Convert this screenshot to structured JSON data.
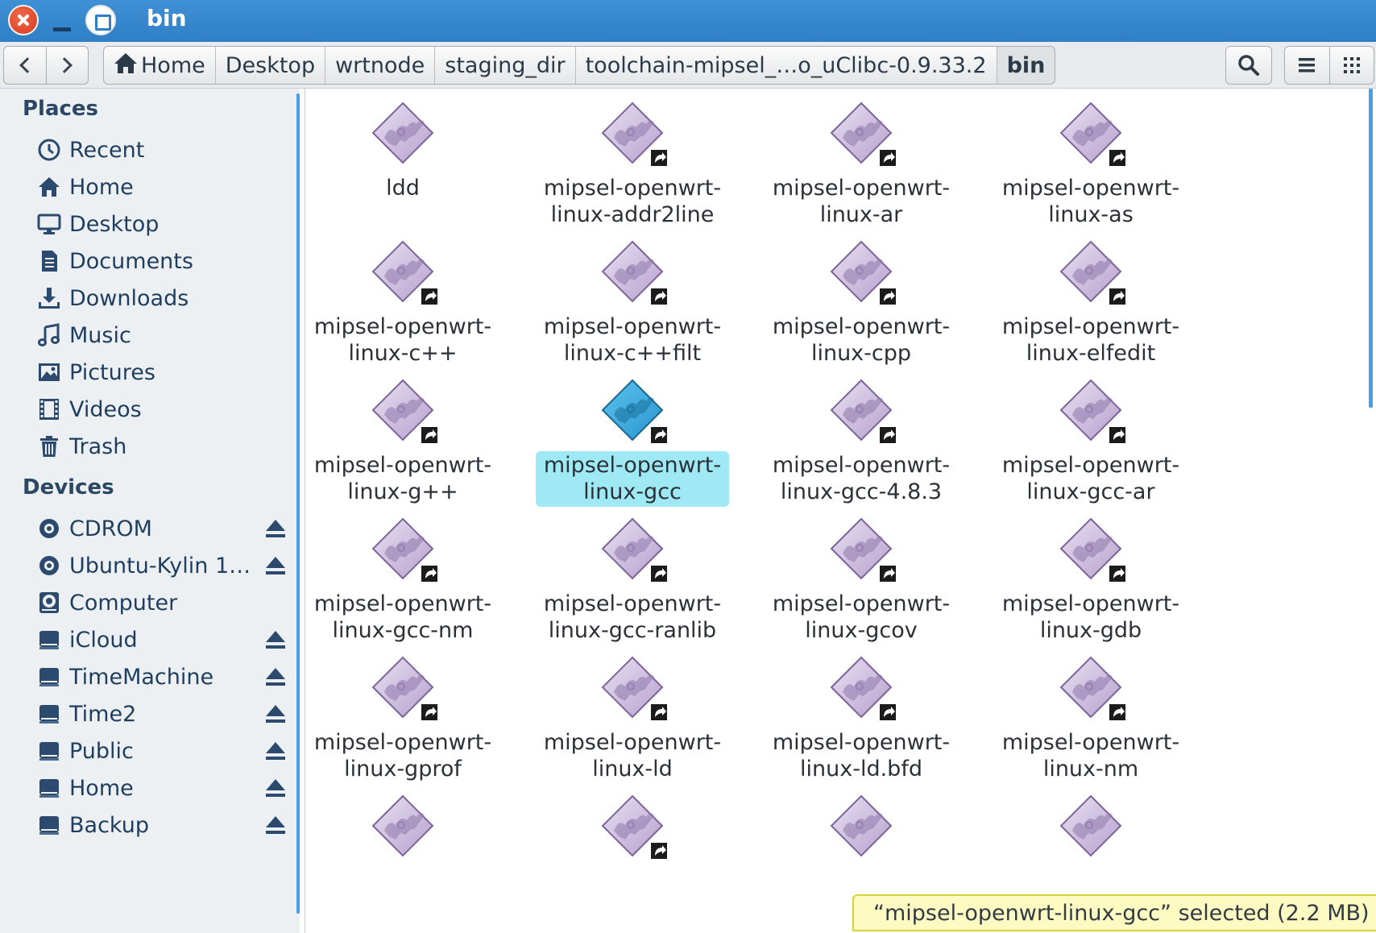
{
  "window": {
    "title": "bin"
  },
  "toolbar": {
    "breadcrumbs": [
      "Home",
      "Desktop",
      "wrtnode",
      "staging_dir",
      "toolchain-mipsel_…o_uClibc-0.9.33.2",
      "bin"
    ]
  },
  "sidebar": {
    "places_header": "Places",
    "devices_header": "Devices",
    "places": [
      {
        "label": "Recent",
        "icon": "clock-icon"
      },
      {
        "label": "Home",
        "icon": "home-icon"
      },
      {
        "label": "Desktop",
        "icon": "monitor-icon"
      },
      {
        "label": "Documents",
        "icon": "document-icon"
      },
      {
        "label": "Downloads",
        "icon": "download-icon"
      },
      {
        "label": "Music",
        "icon": "music-icon"
      },
      {
        "label": "Pictures",
        "icon": "picture-icon"
      },
      {
        "label": "Videos",
        "icon": "film-icon"
      },
      {
        "label": "Trash",
        "icon": "trash-icon"
      }
    ],
    "devices": [
      {
        "label": "CDROM",
        "icon": "disc-icon",
        "eject": true
      },
      {
        "label": "Ubuntu-Kylin 1…",
        "icon": "disc-icon",
        "eject": true
      },
      {
        "label": "Computer",
        "icon": "computer-icon",
        "eject": false
      },
      {
        "label": "iCloud",
        "icon": "drive-icon",
        "eject": true
      },
      {
        "label": "TimeMachine",
        "icon": "drive-icon",
        "eject": true
      },
      {
        "label": "Time2",
        "icon": "drive-icon",
        "eject": true
      },
      {
        "label": "Public",
        "icon": "drive-icon",
        "eject": true
      },
      {
        "label": "Home",
        "icon": "drive-icon",
        "eject": true
      },
      {
        "label": "Backup",
        "icon": "drive-icon",
        "eject": true
      }
    ]
  },
  "files": [
    {
      "name": "ldd",
      "link": false,
      "selected": false
    },
    {
      "name": "mipsel-openwrt-linux-addr2line",
      "link": true,
      "selected": false
    },
    {
      "name": "mipsel-openwrt-linux-ar",
      "link": true,
      "selected": false
    },
    {
      "name": "mipsel-openwrt-linux-as",
      "link": true,
      "selected": false
    },
    {
      "name": "mipsel-openwrt-linux-c++",
      "link": true,
      "selected": false
    },
    {
      "name": "mipsel-openwrt-linux-c++filt",
      "link": true,
      "selected": false
    },
    {
      "name": "mipsel-openwrt-linux-cpp",
      "link": true,
      "selected": false
    },
    {
      "name": "mipsel-openwrt-linux-elfedit",
      "link": true,
      "selected": false
    },
    {
      "name": "mipsel-openwrt-linux-g++",
      "link": true,
      "selected": false
    },
    {
      "name": "mipsel-openwrt-linux-gcc",
      "link": true,
      "selected": true
    },
    {
      "name": "mipsel-openwrt-linux-gcc-4.8.3",
      "link": true,
      "selected": false
    },
    {
      "name": "mipsel-openwrt-linux-gcc-ar",
      "link": true,
      "selected": false
    },
    {
      "name": "mipsel-openwrt-linux-gcc-nm",
      "link": true,
      "selected": false
    },
    {
      "name": "mipsel-openwrt-linux-gcc-ranlib",
      "link": true,
      "selected": false
    },
    {
      "name": "mipsel-openwrt-linux-gcov",
      "link": true,
      "selected": false
    },
    {
      "name": "mipsel-openwrt-linux-gdb",
      "link": true,
      "selected": false
    },
    {
      "name": "mipsel-openwrt-linux-gprof",
      "link": true,
      "selected": false
    },
    {
      "name": "mipsel-openwrt-linux-ld",
      "link": true,
      "selected": false
    },
    {
      "name": "mipsel-openwrt-linux-ld.bfd",
      "link": true,
      "selected": false
    },
    {
      "name": "mipsel-openwrt-linux-nm",
      "link": true,
      "selected": false
    },
    {
      "name": "",
      "link": false,
      "selected": false
    },
    {
      "name": "",
      "link": true,
      "selected": false
    },
    {
      "name": "",
      "link": false,
      "selected": false
    },
    {
      "name": "",
      "link": false,
      "selected": false
    }
  ],
  "status": {
    "text": "“mipsel-openwrt-linux-gcc” selected  (2.2 MB)"
  },
  "colors": {
    "titlebar": "#2f7fc6",
    "selection": "#9fe9f4",
    "status_bg": "#fdfbc2"
  }
}
